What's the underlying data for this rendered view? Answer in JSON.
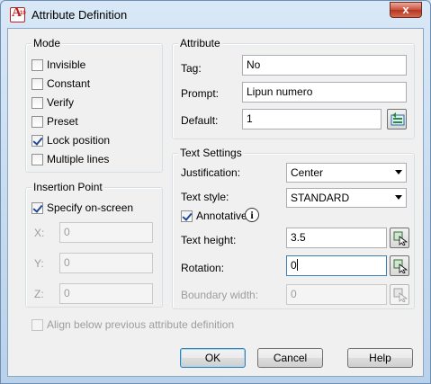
{
  "window": {
    "title": "Attribute Definition",
    "close_glyph": "x",
    "app_icon_letter": "A",
    "app_icon_sub": "10"
  },
  "mode": {
    "title": "Mode",
    "options": [
      {
        "label": "Invisible",
        "checked": false
      },
      {
        "label": "Constant",
        "checked": false
      },
      {
        "label": "Verify",
        "checked": false
      },
      {
        "label": "Preset",
        "checked": false
      },
      {
        "label": "Lock position",
        "checked": true
      },
      {
        "label": "Multiple lines",
        "checked": false
      }
    ]
  },
  "insertion": {
    "title": "Insertion Point",
    "specify_label": "Specify on-screen",
    "specify_checked": true,
    "x_label": "X:",
    "x_value": "0",
    "y_label": "Y:",
    "y_value": "0",
    "z_label": "Z:",
    "z_value": "0"
  },
  "attribute": {
    "title": "Attribute",
    "tag_label": "Tag:",
    "tag_value": "No",
    "prompt_label": "Prompt:",
    "prompt_value": "Lipun numero",
    "default_label": "Default:",
    "default_value": "1"
  },
  "text_settings": {
    "title": "Text Settings",
    "justification_label": "Justification:",
    "justification_value": "Center",
    "text_style_label": "Text style:",
    "text_style_value": "STANDARD",
    "annotative_label": "Annotative",
    "annotative_checked": true,
    "info_glyph": "i",
    "text_height_label": "Text height:",
    "text_height_value": "3.5",
    "rotation_label": "Rotation:",
    "rotation_value": "0",
    "boundary_width_label": "Boundary width:",
    "boundary_width_value": "0"
  },
  "align_below": {
    "label": "Align below previous attribute definition",
    "checked": false
  },
  "buttons": {
    "ok": "OK",
    "cancel": "Cancel",
    "help": "Help"
  },
  "colors": {
    "accent": "#3c7fb1",
    "title_gradient_top": "#d9e8f7",
    "close": "#c9503a"
  }
}
